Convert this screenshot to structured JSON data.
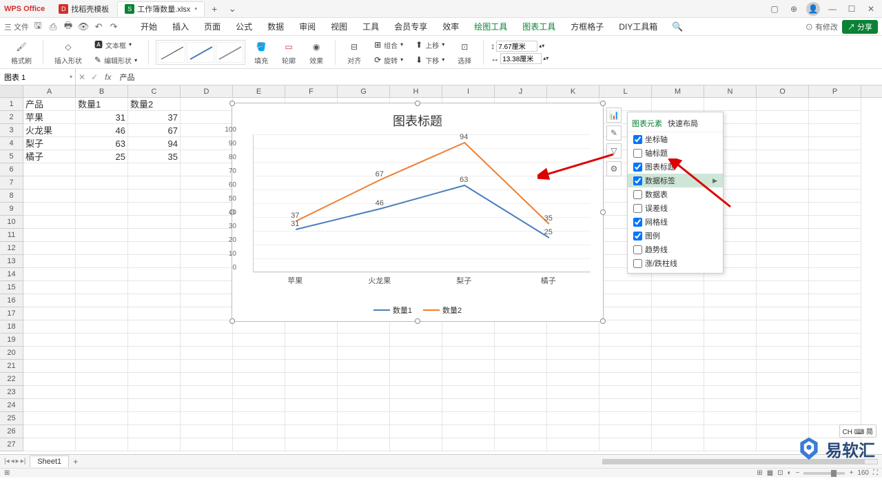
{
  "app": {
    "name": "WPS Office"
  },
  "tabs": [
    {
      "icon": "red",
      "label": "找稻壳模板"
    },
    {
      "icon": "green",
      "label": "工作簿数量.xlsx",
      "dirty": "•"
    }
  ],
  "menu": {
    "file": "三 文件",
    "items": [
      "开始",
      "插入",
      "页面",
      "公式",
      "数据",
      "审阅",
      "视图",
      "工具",
      "会员专享",
      "效率",
      "绘图工具",
      "图表工具",
      "方框格子",
      "DIY工具箱"
    ],
    "modify": "有修改",
    "share": "分享"
  },
  "ribbon": {
    "g1": "格式刷",
    "g2": "插入形状",
    "g3": "文本框",
    "g4": "编辑形状",
    "fill": "填充",
    "outline": "轮廓",
    "effect": "效果",
    "align": "对齐",
    "group": "组合",
    "rotate": "旋转",
    "up": "上移",
    "down": "下移",
    "select": "选择",
    "dim_w": "7.67厘米",
    "dim_h": "13.38厘米"
  },
  "formula": {
    "name": "图表 1",
    "fx": "fx",
    "content": "产品"
  },
  "columns": [
    "A",
    "B",
    "C",
    "D",
    "E",
    "F",
    "G",
    "H",
    "I",
    "J",
    "K",
    "L",
    "M",
    "N",
    "O",
    "P"
  ],
  "rows_count": 27,
  "table": {
    "headers": [
      "产品",
      "数量1",
      "数量2"
    ],
    "rows": [
      [
        "苹果",
        "31",
        "37"
      ],
      [
        "火龙果",
        "46",
        "67"
      ],
      [
        "梨子",
        "63",
        "94"
      ],
      [
        "橘子",
        "25",
        "35"
      ]
    ]
  },
  "chart_data": {
    "type": "line",
    "title": "图表标题",
    "categories": [
      "苹果",
      "火龙果",
      "梨子",
      "橘子"
    ],
    "series": [
      {
        "name": "数量1",
        "color": "#4a7ebb",
        "values": [
          31,
          46,
          63,
          25
        ]
      },
      {
        "name": "数量2",
        "color": "#ed7d31",
        "values": [
          37,
          67,
          94,
          35
        ]
      }
    ],
    "ylim": [
      0,
      100
    ],
    "ystep": 10
  },
  "popup": {
    "tab1": "图表元素",
    "tab2": "快速布局",
    "items": [
      {
        "label": "坐标轴",
        "checked": true
      },
      {
        "label": "轴标题",
        "checked": false
      },
      {
        "label": "图表标题",
        "checked": true
      },
      {
        "label": "数据标签",
        "checked": true,
        "hl": true,
        "arrow": true
      },
      {
        "label": "数据表",
        "checked": false
      },
      {
        "label": "误差线",
        "checked": false
      },
      {
        "label": "网格线",
        "checked": true
      },
      {
        "label": "图例",
        "checked": true
      },
      {
        "label": "趋势线",
        "checked": false
      },
      {
        "label": "涨/跌柱线",
        "checked": false
      }
    ]
  },
  "sheet": {
    "name": "Sheet1"
  },
  "status": {
    "zoom": "160",
    "ime": "CH ⌨ 简"
  },
  "watermark": "易软汇"
}
